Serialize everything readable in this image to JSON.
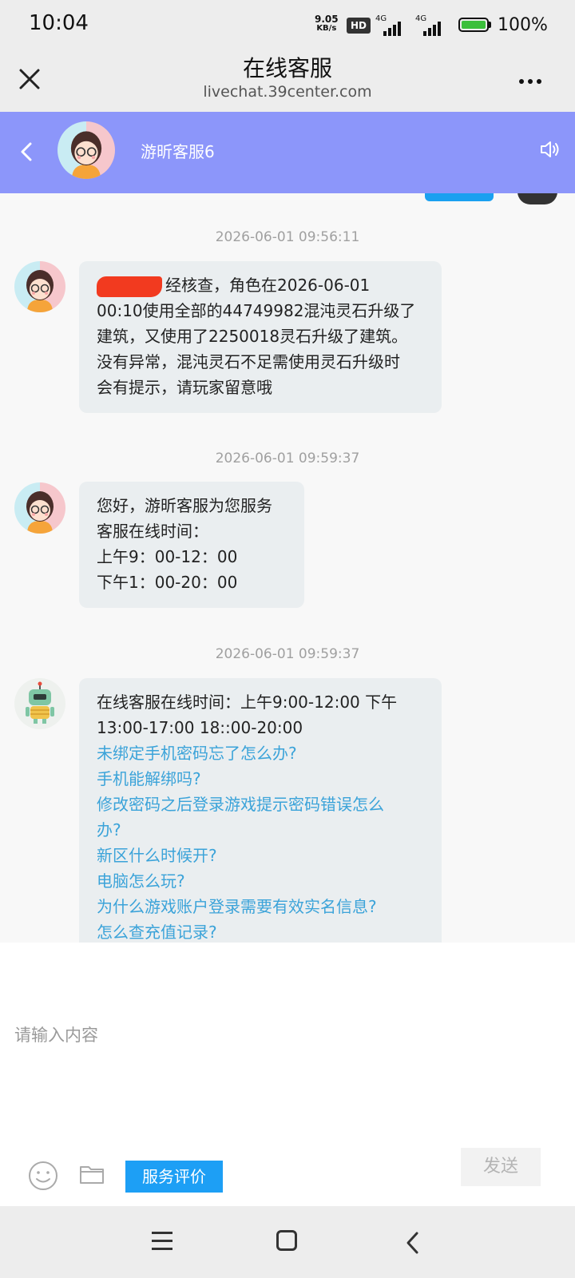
{
  "status_bar": {
    "time": "10:04",
    "net_speed_value": "9.05",
    "net_speed_unit": "KB/s",
    "hd_label": "HD",
    "signal1_label": "4G",
    "signal2_label": "4G",
    "battery_percent": "100%",
    "battery_level": 1.0
  },
  "browser": {
    "title": "在线客服",
    "url": "livechat.39center.com",
    "icons": {
      "close": "close-icon",
      "more": "more-dots-icon"
    }
  },
  "chat_header": {
    "agent_name": "游昕客服6",
    "background_color": "#8c96fa",
    "icons": {
      "back": "chevron-left-icon",
      "speaker": "speaker-icon"
    }
  },
  "messages": [
    {
      "timestamp": "2026-06-01 09:56:11",
      "sender": "agent",
      "lines": [
        "经核查，角色在2026-06-01",
        "00:10使用全部的44749982混沌灵石升级了",
        "建筑，又使用了2250018灵石升级了建筑。",
        "没有异常，混沌灵石不足需使用灵石升级时",
        "会有提示，请玩家留意哦"
      ]
    },
    {
      "timestamp": "2026-06-01 09:59:37",
      "sender": "agent",
      "lines": [
        "您好，游昕客服为您服务",
        "客服在线时间：",
        "上午9：00-12：00",
        "下午1：00-20：00"
      ]
    },
    {
      "timestamp": "2026-06-01 09:59:37",
      "sender": "bot",
      "lines": [
        "在线客服在线时间：上午9:00-12:00 下午",
        "13:00-17:00 18::00-20:00"
      ],
      "links": [
        "未绑定手机密码忘了怎么办?",
        "手机能解绑吗?",
        "修改密码之后登录游戏提示密码错误怎么",
        "办?",
        "新区什么时候开?",
        "电脑怎么玩?",
        "为什么游戏账户登录需要有效实名信息?",
        "怎么查充值记录?"
      ]
    }
  ],
  "input": {
    "placeholder": "请输入内容",
    "rate_button": "服务评价",
    "send_button": "发送",
    "icons": {
      "emoji": "emoji-icon",
      "folder": "folder-icon"
    }
  },
  "nav_bar": {
    "icons": {
      "menu": "menu-icon",
      "home": "home-icon",
      "back": "back-icon"
    }
  },
  "colors": {
    "link": "#3ba3d9",
    "rate_button": "#1d9ff5",
    "bubble": "#eaeef0"
  }
}
